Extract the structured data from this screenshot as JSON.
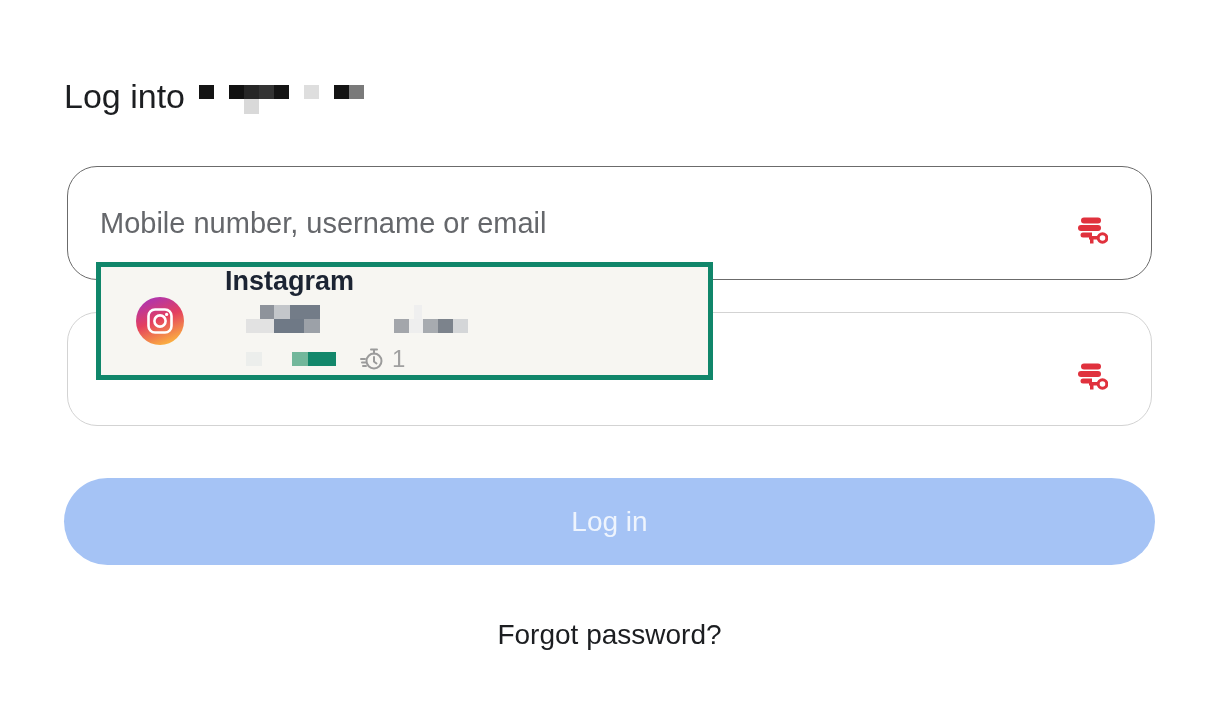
{
  "heading": {
    "text": "Log into"
  },
  "form": {
    "fields": [
      {
        "placeholder": "Mobile number, username or email",
        "focused": true
      },
      {
        "focused": false
      }
    ]
  },
  "autofill_popup": {
    "suggestions": [
      {
        "app_name": "Instagram",
        "count": "1",
        "selected": true
      }
    ]
  },
  "login_button": {
    "label": "Log in",
    "disabled": true
  },
  "forgot_link": {
    "label": "Forgot password?"
  }
}
